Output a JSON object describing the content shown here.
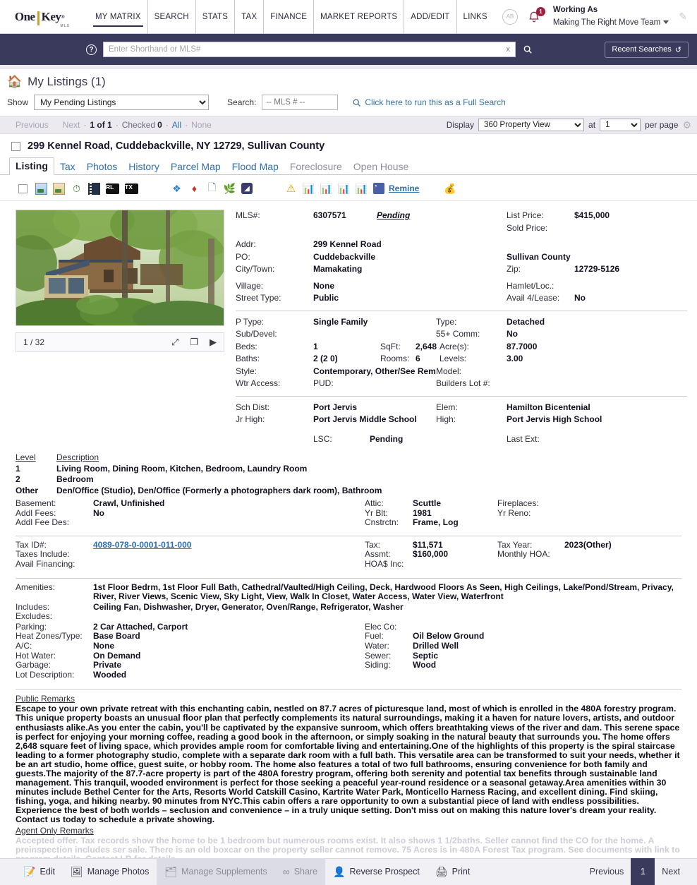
{
  "header": {
    "logo_one": "One",
    "logo_key": "Key",
    "logo_sub": "MLS",
    "nav": [
      {
        "label": "MY MATRIX",
        "active": true
      },
      {
        "label": "SEARCH",
        "active": false
      },
      {
        "label": "STATS",
        "active": false
      },
      {
        "label": "TAX",
        "active": false
      },
      {
        "label": "FINANCE",
        "active": false
      },
      {
        "label": "MARKET REPORTS",
        "active": false
      },
      {
        "label": "ADD/EDIT",
        "active": false
      },
      {
        "label": "LINKS",
        "active": false
      }
    ],
    "avatar_initials": "AB",
    "notification_count": "1",
    "working_as_label": "Working As",
    "working_as_name": "Making The Right Move Team"
  },
  "search": {
    "placeholder": "Enter Shorthand or MLS#",
    "value": "",
    "clear_label": "x",
    "recent_searches": "Recent Searches",
    "help_label": "?"
  },
  "listpage": {
    "title": "My Listings (1)",
    "show_label": "Show",
    "show_value": "My Pending Listings",
    "show_options": [
      "My Pending Listings"
    ],
    "search_label": "Search:",
    "mls_placeholder": "-- MLS # --",
    "full_search_link": "Click here to run this as a Full Search"
  },
  "navstrip": {
    "previous": "Previous",
    "next": "Next",
    "count": "1 of 1",
    "checked_label": "Checked",
    "checked_count": "0",
    "all": "All",
    "none": "None",
    "display_label": "Display",
    "display_value": "360 Property View",
    "display_options": [
      "360 Property View"
    ],
    "at_label": "at",
    "perpage_value": "1",
    "perpage_options": [
      "1"
    ],
    "perpage_label": "per page"
  },
  "listing": {
    "address_title": "299 Kennel Road, Cuddebackville, NY 12729, Sullivan County",
    "tabs": [
      {
        "label": "Listing",
        "state": "active"
      },
      {
        "label": "Tax",
        "state": "link"
      },
      {
        "label": "Photos",
        "state": "link"
      },
      {
        "label": "History",
        "state": "link"
      },
      {
        "label": "Parcel Map",
        "state": "link"
      },
      {
        "label": "Flood Map",
        "state": "link"
      },
      {
        "label": "Foreclosure",
        "state": "dim"
      },
      {
        "label": "Open House",
        "state": "dim"
      }
    ],
    "toolbar": {
      "remine_label": "Remine",
      "rl_label": "RL",
      "tx_label": "TX"
    },
    "photo": {
      "counter": "1 / 32"
    },
    "facts": {
      "mls_label": "MLS#:",
      "mls_value": "6307571",
      "mls_status": "Pending",
      "list_price_label": "List Price:",
      "list_price_value": "$415,000",
      "sold_price_label": "Sold Price:",
      "sold_price_value": "",
      "addr_label": "Addr:",
      "addr_value": "299 Kennel Road",
      "po_label": "PO:",
      "po_value": "Cuddebackville",
      "county_value": "Sullivan County",
      "city_label": "City/Town:",
      "city_value": "Mamakating",
      "zip_label": "Zip:",
      "zip_value": "12729-5126",
      "village_label": "Village:",
      "village_value": "None",
      "hamlet_label": "Hamlet/Loc.:",
      "hamlet_value": "",
      "street_type_label": "Street Type:",
      "street_type_value": "Public",
      "avail_lease_label": "Avail 4/Lease:",
      "avail_lease_value": "No",
      "ptype_label": "P Type:",
      "ptype_value": "Single Family",
      "type_label": "Type:",
      "type_value": "Detached",
      "subdevel_label": "Sub/Devel:",
      "subdevel_value": "",
      "comm55_label": "55+ Comm:",
      "comm55_value": "No",
      "beds_label": "Beds:",
      "beds_value": "1",
      "sqft_label": "SqFt:",
      "sqft_value": "2,648",
      "acres_label": "Acre(s):",
      "acres_value": "87.7000",
      "baths_label": "Baths:",
      "baths_value": "2 (2 0)",
      "rooms_label": "Rooms:",
      "rooms_value": "6",
      "levels_label": "Levels:",
      "levels_value": "3.00",
      "style_label": "Style:",
      "style_value": "Contemporary, Other/See Remarks",
      "model_label": "Model:",
      "model_value": "",
      "wtr_access_label": "Wtr Access:",
      "wtr_access_value": "",
      "pud_label": "PUD:",
      "pud_value": "",
      "builders_lot_label": "Builders Lot #:",
      "builders_lot_value": "",
      "sch_dist_label": "Sch Dist:",
      "sch_dist_value": "Port Jervis",
      "elem_label": "Elem:",
      "elem_value": "Hamilton Bicentenial",
      "jr_high_label": "Jr High:",
      "jr_high_value": "Port Jervis Middle School",
      "high_label": "High:",
      "high_value": "Port Jervis High School",
      "lsc_label": "LSC:",
      "lsc_value": "Pending",
      "last_ext_label": "Last Ext:",
      "last_ext_value": ""
    },
    "levels": {
      "level_header": "Level",
      "description_header": "Description",
      "rows": [
        {
          "level": "1",
          "desc": "Living Room, Dining Room, Kitchen, Bedroom, Laundry Room"
        },
        {
          "level": "2",
          "desc": "Bedroom"
        },
        {
          "level": "Other",
          "desc": "Den/Office (Studio), Den/Office (Formerly a photographers dark room), Bathroom"
        }
      ]
    },
    "structure": {
      "basement_label": "Basement:",
      "basement_value": "Crawl, Unfinished",
      "attic_label": "Attic:",
      "attic_value": "Scuttle",
      "fireplaces_label": "Fireplaces:",
      "fireplaces_value": "",
      "addl_fees_label": "Addl Fees:",
      "addl_fees_value": "No",
      "yr_blt_label": "Yr Blt:",
      "yr_blt_value": "1981",
      "yr_reno_label": "Yr Reno:",
      "yr_reno_value": "",
      "addl_fee_des_label": "Addl Fee Des:",
      "addl_fee_des_value": "",
      "cnstrctn_label": "Cnstrctn:",
      "cnstrctn_value": "Frame, Log"
    },
    "tax": {
      "tax_id_label": "Tax ID#:",
      "tax_id_value": "4089-078-0-0001-011-000",
      "tax_label": "Tax:",
      "tax_value": "$11,571",
      "tax_year_label": "Tax Year:",
      "tax_year_value": "2023(Other)",
      "taxes_include_label": "Taxes Include:",
      "taxes_include_value": "",
      "assmt_label": "Assmt:",
      "assmt_value": "$160,000",
      "monthly_hoa_label": "Monthly HOA:",
      "monthly_hoa_value": "",
      "avail_financing_label": "Avail Financing:",
      "avail_financing_value": "",
      "hoa_inc_label": "HOA$ Inc:",
      "hoa_inc_value": ""
    },
    "amenities": {
      "amenities_label": "Amenities:",
      "amenities_value": "1st Floor Bedrm, 1st Floor Full Bath, Cathedral/Vaulted/High Ceiling, Deck, Hardwood Floors As Seen, High Ceilings, Lake/Pond/Stream, Privacy, River, River Views, Scenic View, Sky Light, View, Walk In Closet, Water Access, Water View, Waterfront",
      "includes_label": "Includes:",
      "includes_value": "Ceiling Fan, Dishwasher, Dryer, Generator, Oven/Range, Refrigerator, Washer",
      "excludes_label": "Excludes:",
      "excludes_value": ""
    },
    "systems": {
      "parking_label": "Parking:",
      "parking_value": "2 Car Attached, Carport",
      "elec_co_label": "Elec Co:",
      "elec_co_value": "",
      "heat_label": "Heat Zones/Type:",
      "heat_value": "Base Board",
      "fuel_label": "Fuel:",
      "fuel_value": "Oil Below Ground",
      "ac_label": "A/C:",
      "ac_value": "None",
      "water_label": "Water:",
      "water_value": "Drilled Well",
      "hot_water_label": "Hot Water:",
      "hot_water_value": "On Demand",
      "sewer_label": "Sewer:",
      "sewer_value": "Septic",
      "garbage_label": "Garbage:",
      "garbage_value": "Private",
      "siding_label": "Siding:",
      "siding_value": "Wood",
      "lot_desc_label": "Lot Description:",
      "lot_desc_value": "Wooded"
    },
    "public_remarks_title": "Public Remarks",
    "public_remarks": "Escape to your own private retreat with this enchanting cabin, nestled on 87.7 acres of picturesque land, most of which is enrolled in the 480A forestry program. This unique property boasts an unusual floor plan that perfectly complements its natural surroundings, making it a haven for nature lovers, artists, and outdoor enthusiasts alike.As you enter the cabin, you'll be captivated by the expansive sunroom, which offers breathtaking views of the river and dam. This serene space is perfect for enjoying your morning coffee, reading a good book in the afternoon, or simply soaking in the natural beauty that surrounds you. The home offers 2,648 square feet of living space, which provides ample room for comfortable living and entertaining.One of the highlights of this property is the spiral staircase leading to a former photography studio, complete with a separate dark room with a full bath. This versatile area can be transformed to suit your needs, whether it be an art studio, home office, guest suite, or hobby room. The home also features a total of two full bathrooms, ensuring convenience for both family and guests.The majority of the 87.7-acre property is part of the 480A forestry program, offering both serenity and potential tax benefits through sustainable land management. This tranquil, wooded environment is perfect for those seeking a peaceful year-round residence or a seasonal getaway.Area amenities within 30 minutes include Bethel Center for the Arts, Resorts World Catskill Casino, Kartrite Water Park, Monticello Harness Racing, and excellent dining. Find skiing, fishing, yoga, and hiking nearby. 90 minutes from NYC.This cabin offers a rare opportunity to own a substantial piece of land with endless possibilities. Experience the best of both worlds – seclusion and convenience – in a truly unique setting. Don't miss out on making this nature lover's dream your reality. Contact us today to schedule a private showing.",
    "agent_remarks_title": "Agent Only Remarks",
    "agent_remarks": "Accepted offer. Tax records show the home to be 1 bedroom but numerous rooms exist. It also shows 1 1/2baths. Seller cannot find the CO for the home. A preinspection includes ser sale. There is an old boxcar on the property seller cannot remove. 75 Acres is in 480A Forest Tax program. See documents with link to program details. Contact LB for details"
  },
  "bottombar": {
    "buttons": [
      {
        "label": "Edit",
        "icon": "edit-icon",
        "disabled": false
      },
      {
        "label": "Manage Photos",
        "icon": "photos-icon",
        "disabled": false
      },
      {
        "label": "Manage Supplements",
        "icon": "supplements-icon",
        "disabled": true
      },
      {
        "label": "Share",
        "icon": "share-icon",
        "disabled": true
      },
      {
        "label": "Reverse Prospect",
        "icon": "prospect-icon",
        "disabled": false
      },
      {
        "label": "Print",
        "icon": "print-icon",
        "disabled": false
      }
    ],
    "previous": "Previous",
    "page": "1",
    "next": "Next"
  },
  "colors": {
    "navy": "#3a3a5c",
    "link": "#2f6fae",
    "badge_red": "#a01b3c",
    "panel_bg": "#eceaf0"
  }
}
